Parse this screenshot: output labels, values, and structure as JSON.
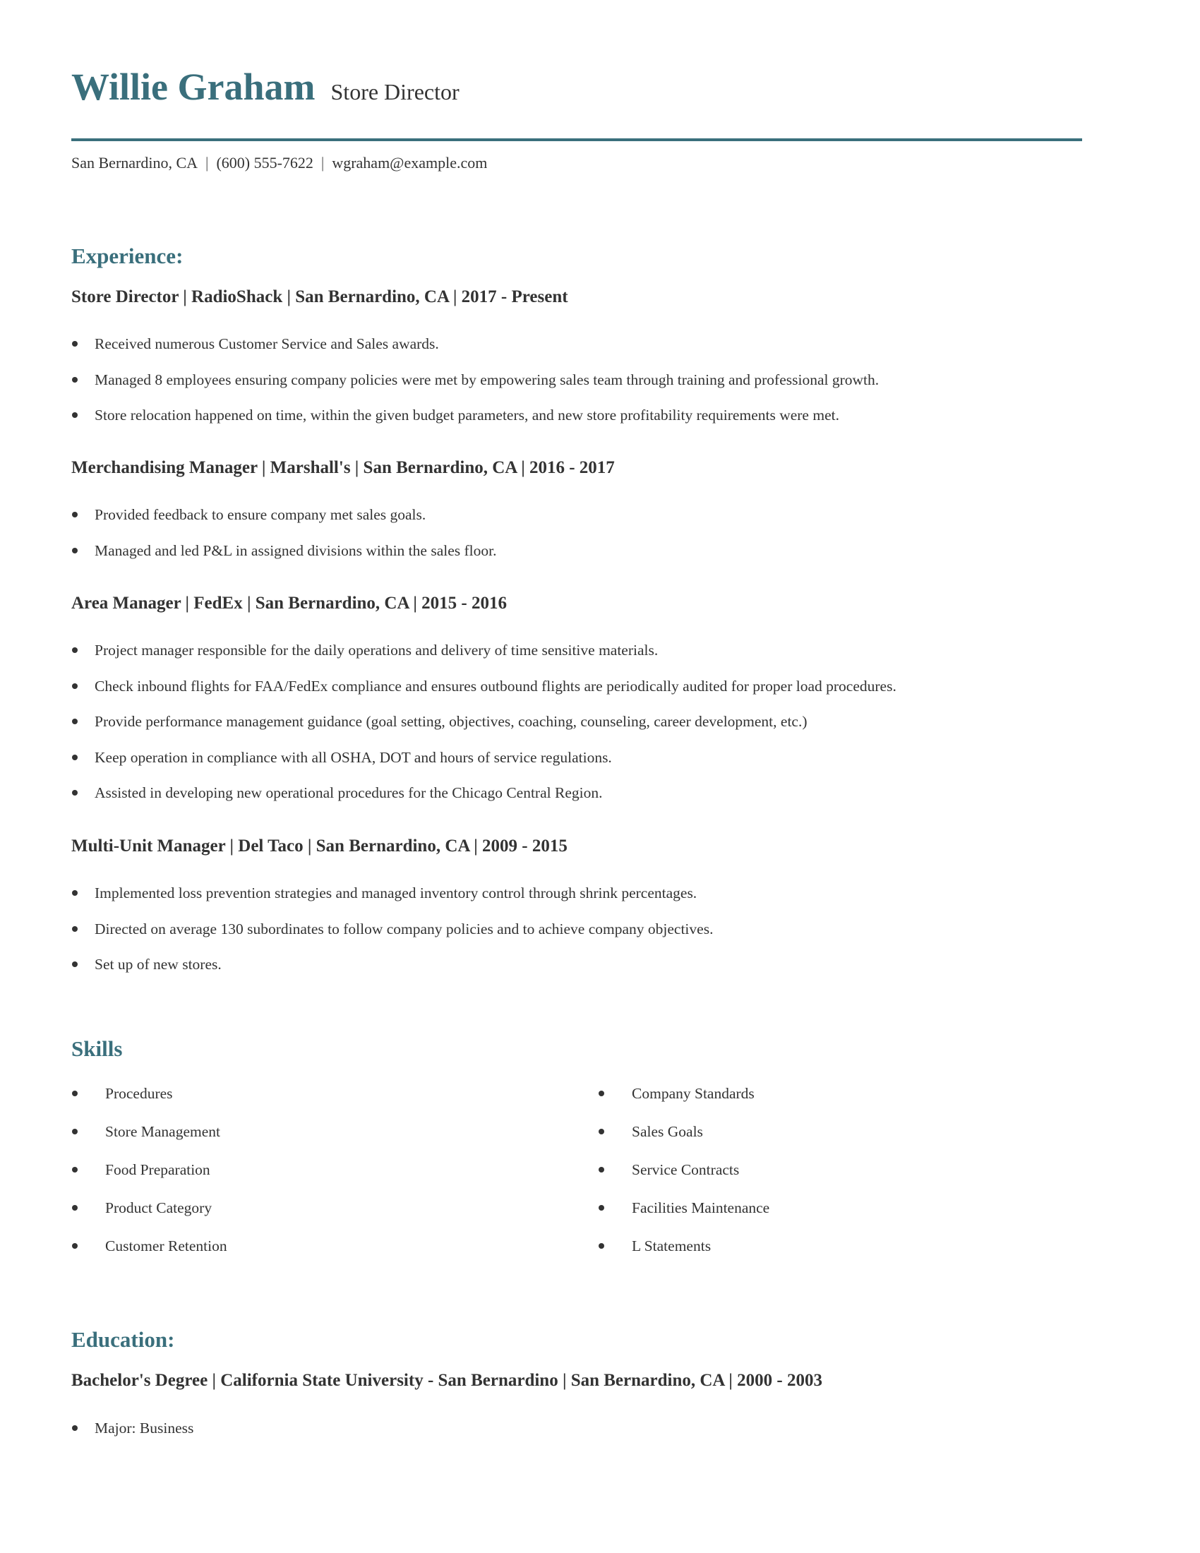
{
  "header": {
    "name": "Willie Graham",
    "title": "Store Director",
    "contact": {
      "location": "San Bernardino, CA",
      "phone": "(600) 555-7622",
      "email": "wgraham@example.com",
      "separator": "|"
    }
  },
  "experience": {
    "heading": "Experience:",
    "jobs": [
      {
        "title": "Store Director | RadioShack | San Bernardino, CA |  2017 - Present",
        "bullets": [
          "Received numerous Customer Service and Sales awards.",
          "Managed 8 employees ensuring company policies were met by empowering sales team through training and professional growth.",
          "Store relocation happened on time, within the given budget parameters, and new store profitability requirements were met."
        ]
      },
      {
        "title": "Merchandising Manager | Marshall's | San Bernardino, CA |  2016 - 2017",
        "bullets": [
          "Provided feedback to ensure company met sales goals.",
          "Managed and led P&L in assigned divisions within the sales floor."
        ]
      },
      {
        "title": "Area Manager | FedEx | San Bernardino, CA |  2015 - 2016",
        "bullets": [
          "Project manager responsible for the daily operations and delivery of time sensitive materials.",
          "Check inbound flights for FAA/FedEx compliance and ensures outbound flights are periodically audited for proper load procedures.",
          "Provide performance management guidance (goal setting, objectives, coaching, counseling, career development, etc.)",
          "Keep operation in compliance with all OSHA, DOT and hours of service regulations.",
          "Assisted in developing new operational procedures for the Chicago Central Region."
        ]
      },
      {
        "title": "Multi-Unit Manager | Del Taco | San Bernardino, CA |  2009 - 2015",
        "bullets": [
          "Implemented loss prevention strategies and managed inventory control through shrink percentages.",
          "Directed on average 130 subordinates to follow company policies and to achieve company objectives.",
          "Set up of new stores."
        ]
      }
    ]
  },
  "skills": {
    "heading": "Skills",
    "left": [
      "Procedures",
      "Store Management",
      "Food Preparation",
      "Product Category",
      "Customer Retention"
    ],
    "right": [
      "Company Standards",
      "Sales Goals",
      "Service Contracts",
      "Facilities Maintenance",
      "L Statements"
    ]
  },
  "education": {
    "heading": "Education:",
    "entries": [
      {
        "title": "Bachelor's Degree | California State University - San Bernardino | San Bernardino, CA |  2000 - 2003",
        "bullets": [
          "Major: Business"
        ]
      }
    ]
  },
  "colors": {
    "accent": "#3a6f7c",
    "text": "#333333"
  }
}
